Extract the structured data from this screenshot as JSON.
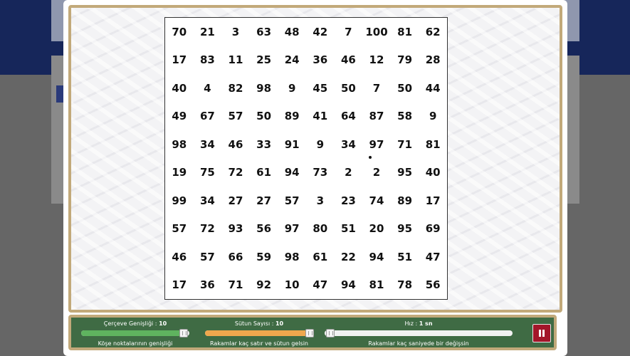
{
  "grid": {
    "rows": [
      [
        70,
        21,
        3,
        63,
        48,
        42,
        7,
        100,
        81,
        62
      ],
      [
        17,
        83,
        11,
        25,
        24,
        36,
        46,
        12,
        79,
        28
      ],
      [
        40,
        4,
        82,
        98,
        9,
        45,
        50,
        7,
        50,
        44
      ],
      [
        49,
        67,
        57,
        50,
        89,
        41,
        64,
        87,
        58,
        9
      ],
      [
        98,
        34,
        46,
        33,
        91,
        9,
        34,
        97,
        71,
        81
      ],
      [
        19,
        75,
        72,
        61,
        94,
        73,
        2,
        2,
        95,
        40
      ],
      [
        99,
        34,
        27,
        27,
        57,
        3,
        23,
        74,
        89,
        17
      ],
      [
        57,
        72,
        93,
        56,
        97,
        80,
        51,
        20,
        95,
        69
      ],
      [
        46,
        57,
        66,
        59,
        98,
        61,
        22,
        94,
        51,
        47
      ],
      [
        17,
        36,
        71,
        92,
        10,
        47,
        94,
        81,
        78,
        56
      ]
    ]
  },
  "controls": {
    "frame_width": {
      "label": "Çerçeve Genişliği :",
      "value": "10",
      "description": "Köşe noktalarının genişliği",
      "level": 0.95,
      "color": "#5fb35f"
    },
    "column_count": {
      "label": "Sütun Sayısı :",
      "value": "10",
      "description": "Rakamlar kaç satır ve sütun gelsin",
      "level": 0.97,
      "color": "#efa74d"
    },
    "speed": {
      "label": "Hız :",
      "value": "1 sn",
      "description": "Rakamlar kaç saniyede bir değişsin",
      "level": 0.03,
      "color": "#f2f2f2"
    },
    "pause_icon": "pause-icon",
    "pause_color": "#a3162a"
  }
}
